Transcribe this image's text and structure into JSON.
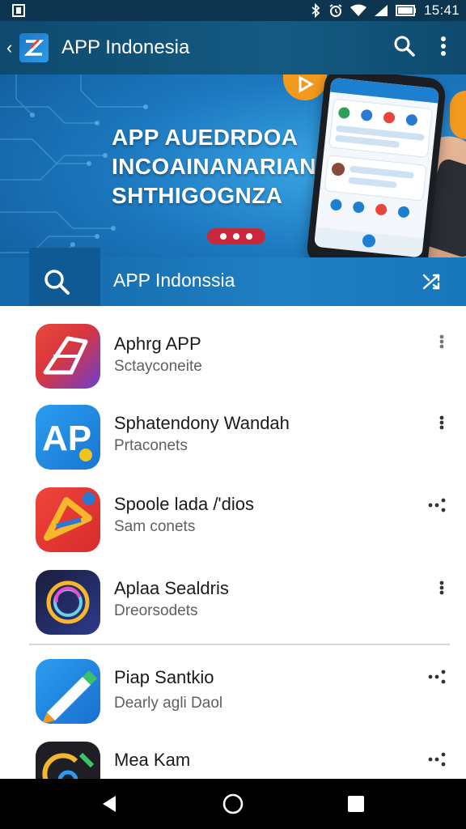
{
  "status_bar": {
    "time": "15:41",
    "icons": [
      "notification-icon",
      "bluetooth-icon",
      "alarm-icon",
      "wifi-icon",
      "signal-icon",
      "battery-icon"
    ]
  },
  "app_bar": {
    "title": "APP Indonesia",
    "actions": [
      "search-icon",
      "more-vert-icon"
    ]
  },
  "banner": {
    "headline": [
      "APP AUEDRDOA",
      "INCOAINANARIAN",
      "SHTHIGOGNZA"
    ],
    "colors": {
      "dots_pill": "#c8283a",
      "play_badge": "#f39a1e"
    }
  },
  "search": {
    "text": "APP Indonssia"
  },
  "apps": [
    {
      "name": "Aphrg APP",
      "subtitle": "Sctayconeite"
    },
    {
      "name": "Sphatendony Wandah",
      "subtitle": "Prtaconets"
    },
    {
      "name": "Spoole lada /'dios",
      "subtitle": "Sam conets"
    },
    {
      "name": "Aplaa Sealdris",
      "subtitle": "Dreorsodets"
    },
    {
      "name": "Piap Santkio",
      "subtitle": "Dearly agli Daol"
    },
    {
      "name": "Mea Kam",
      "subtitle": ""
    }
  ],
  "nav": [
    "back-icon",
    "home-icon",
    "recents-icon"
  ]
}
